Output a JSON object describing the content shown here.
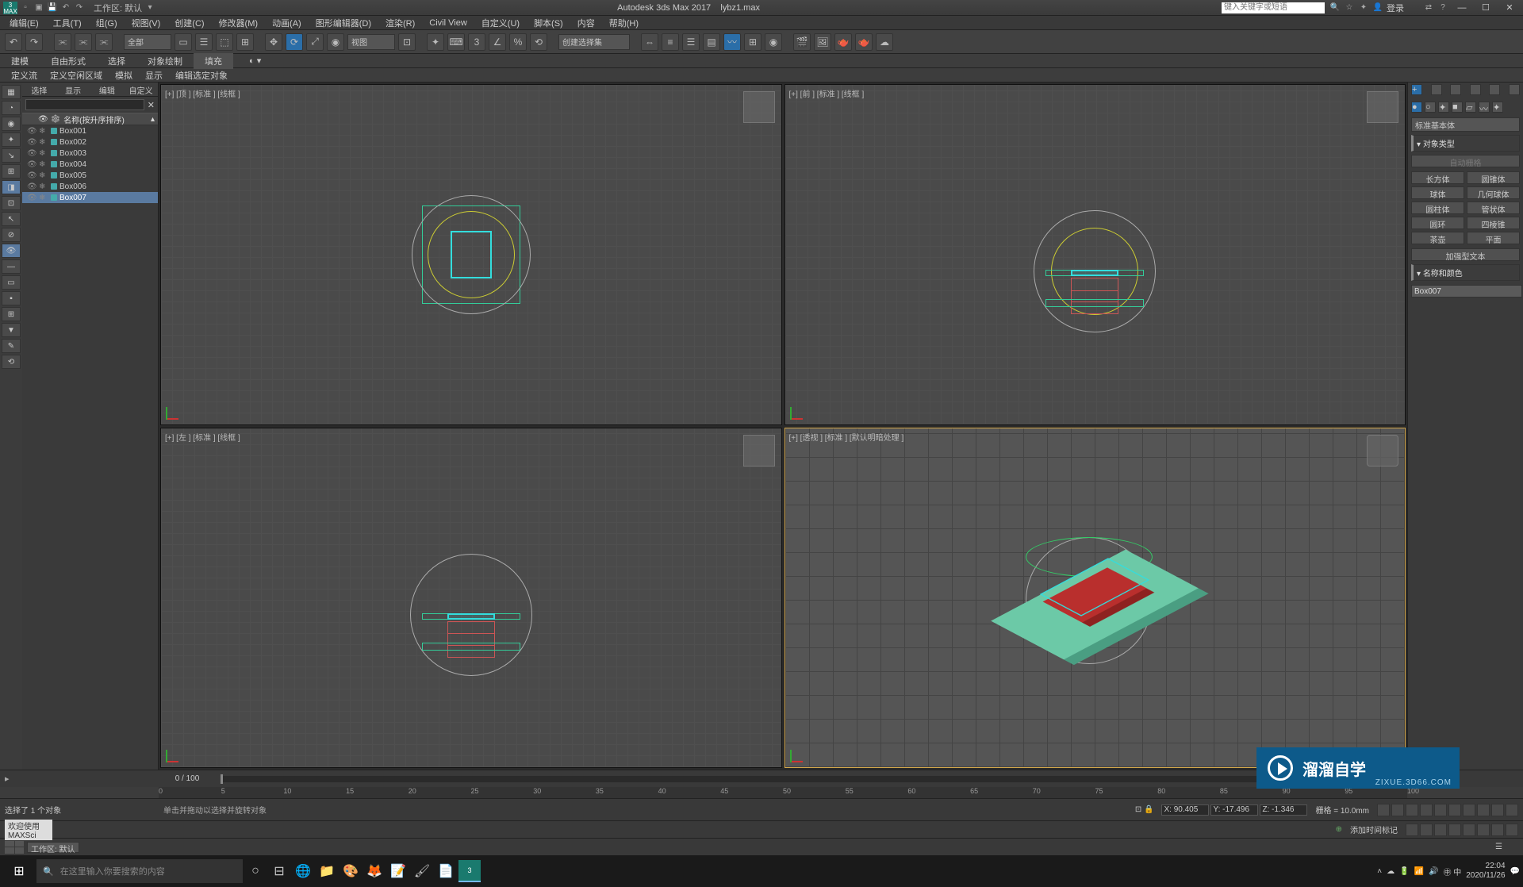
{
  "title": {
    "app": "Autodesk 3ds Max 2017",
    "file": "lybz1.max",
    "workspace_label": "工作区: 默认",
    "login": "登录"
  },
  "search_placeholder": "键入关键字或短语",
  "menus": [
    "编辑(E)",
    "工具(T)",
    "组(G)",
    "视图(V)",
    "创建(C)",
    "修改器(M)",
    "动画(A)",
    "图形编辑器(D)",
    "渲染(R)",
    "Civil View",
    "自定义(U)",
    "脚本(S)",
    "内容",
    "帮助(H)"
  ],
  "toolbar_dropdowns": {
    "filter": "全部",
    "view": "视图",
    "sets": "创建选择集"
  },
  "ribbon_tabs": [
    "建模",
    "自由形式",
    "选择",
    "对象绘制",
    "填充"
  ],
  "ribbon_sub": [
    "定义流",
    "定义空闲区域",
    "模拟",
    "显示",
    "编辑选定对象"
  ],
  "scene_explorer": {
    "tabs": [
      "选择",
      "显示",
      "编辑",
      "自定义"
    ],
    "header": "名称(按升序排序)",
    "items": [
      {
        "name": "Box001"
      },
      {
        "name": "Box002"
      },
      {
        "name": "Box003"
      },
      {
        "name": "Box004"
      },
      {
        "name": "Box005"
      },
      {
        "name": "Box006"
      },
      {
        "name": "Box007",
        "selected": true
      }
    ]
  },
  "viewports": {
    "top": "[+] [顶 ] [标准 ] [线框 ]",
    "front": "[+] [前 ] [标准 ] [线框 ]",
    "left": "[+] [左 ] [标准 ] [线框 ]",
    "persp": "[+] [透视 ] [标准 ] [默认明暗处理 ]"
  },
  "timeline": {
    "frame": "0 / 100",
    "ticks": [
      "0",
      "5",
      "10",
      "15",
      "20",
      "25",
      "30",
      "35",
      "40",
      "45",
      "50",
      "55",
      "60",
      "65",
      "70",
      "75",
      "80",
      "85",
      "90",
      "95",
      "100"
    ]
  },
  "status": {
    "selection": "选择了 1 个对象",
    "hint": "单击并拖动以选择并旋转对象",
    "welcome": "欢迎使用 MAXSci",
    "x": "X: 90.405",
    "y": "Y: -17.496",
    "z": "Z: -1.346",
    "grid": "栅格 = 10.0mm",
    "addtime": "添加时间标记",
    "workspace": "工作区: 默认"
  },
  "command_panel": {
    "dropdown": "标准基本体",
    "rollout_type": "对象类型",
    "auto_grid": "自动栅格",
    "buttons": [
      [
        "长方体",
        "圆锥体"
      ],
      [
        "球体",
        "几何球体"
      ],
      [
        "圆柱体",
        "管状体"
      ],
      [
        "圆环",
        "四棱锥"
      ],
      [
        "茶壶",
        "平面"
      ]
    ],
    "extra_btn": "加强型文本",
    "rollout_name": "名称和颜色",
    "name_value": "Box007"
  },
  "watermark": {
    "text": "溜溜自学",
    "sub": "ZIXUE.3D66.COM"
  },
  "taskbar": {
    "search": "在这里输入你要搜索的内容",
    "time": "22:04",
    "date": "2020/11/26"
  }
}
